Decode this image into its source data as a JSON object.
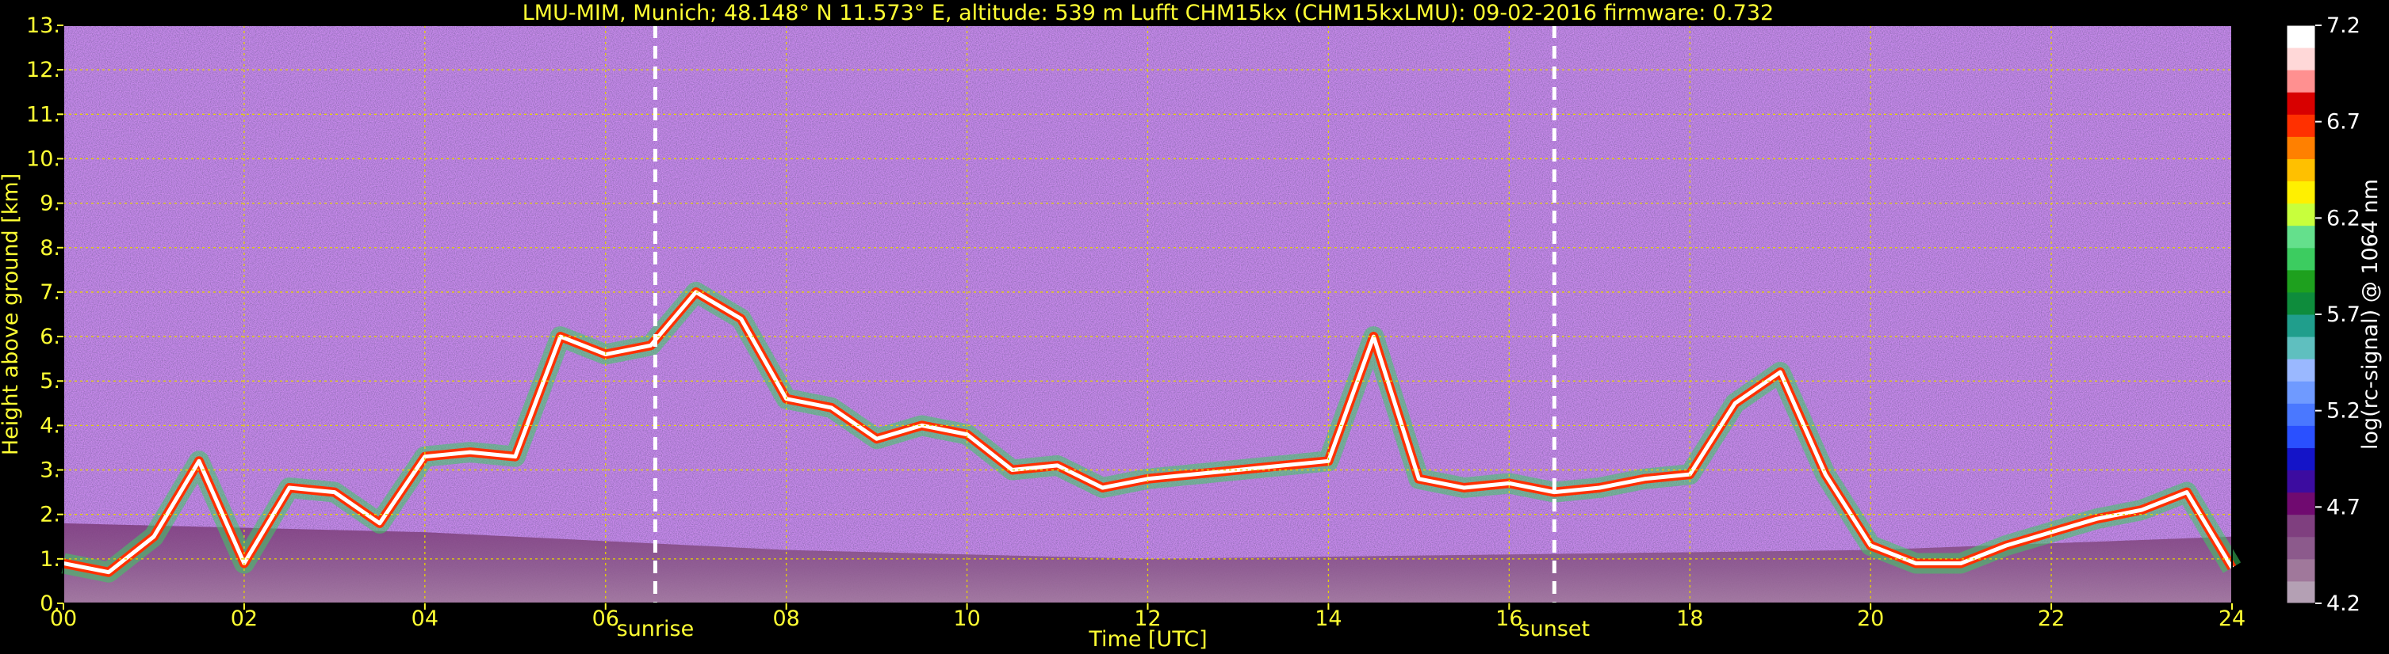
{
  "chart_data": {
    "type": "heatmap",
    "title": "LMU-MIM, Munich; 48.148° N 11.573° E, altitude: 539 m    Lufft CHM15kx (CHM15kxLMU): 09-02-2016    firmware: 0.732",
    "xlabel": "Time [UTC]",
    "ylabel": "Height above ground [km]",
    "xlim": [
      0,
      24
    ],
    "ylim": [
      0,
      13
    ],
    "x_ticks": [
      "00",
      "02",
      "04",
      "06",
      "08",
      "10",
      "12",
      "14",
      "16",
      "18",
      "20",
      "22",
      "24"
    ],
    "y_ticks": [
      "0.",
      "1.",
      "2.",
      "3.",
      "4.",
      "5.",
      "6.",
      "7.",
      "8.",
      "9.",
      "10.",
      "11.",
      "12.",
      "13."
    ],
    "grid": true,
    "markers": [
      {
        "label": "sunrise",
        "x": 6.55
      },
      {
        "label": "sunset",
        "x": 16.5
      }
    ],
    "colorbar": {
      "label": "log(rc-signal) @ 1064 nm",
      "range": [
        4.2,
        7.2
      ],
      "ticks": [
        "7.2",
        "6.7",
        "6.2",
        "5.7",
        "5.2",
        "4.7",
        "4.2"
      ],
      "colors": [
        "#b4a0b4",
        "#a0789b",
        "#8c5a8c",
        "#7f3f7f",
        "#700a70",
        "#3c0ca0",
        "#1414c8",
        "#2a50ff",
        "#4a78ff",
        "#6f9aff",
        "#9ab8ff",
        "#5fbfbf",
        "#209e8c",
        "#0e8c3c",
        "#1ea01e",
        "#3ccc60",
        "#64e08c",
        "#c8ff3c",
        "#fff000",
        "#ffc000",
        "#ff8000",
        "#ff3000",
        "#d80000",
        "#ff9090",
        "#ffd8d8",
        "#ffffff"
      ]
    },
    "layers": [
      {
        "name": "cloud_layer",
        "x": [
          0.0,
          0.5,
          1.0,
          1.5,
          2.0,
          2.5,
          3.0,
          3.5,
          4.0,
          4.5,
          5.0,
          5.5,
          6.0,
          6.5,
          7.0,
          7.5,
          8.0,
          8.5,
          9.0,
          9.5,
          10.0,
          10.5,
          11.0,
          11.5,
          12.0,
          12.5,
          13.0,
          13.5,
          14.0,
          14.5,
          15.0,
          15.5,
          16.0,
          16.5,
          17.0,
          17.5,
          18.0,
          18.5,
          19.0,
          19.5,
          20.0,
          20.5,
          21.0,
          21.5,
          22.0,
          22.5,
          23.0,
          23.5,
          24.0
        ],
        "y": [
          0.9,
          0.7,
          1.5,
          3.2,
          0.9,
          2.6,
          2.5,
          1.8,
          3.3,
          3.4,
          3.3,
          6.0,
          5.6,
          5.8,
          7.0,
          6.4,
          4.6,
          4.4,
          3.7,
          4.0,
          3.8,
          3.0,
          3.1,
          2.6,
          2.8,
          2.9,
          3.0,
          3.1,
          3.2,
          6.0,
          2.8,
          2.6,
          2.7,
          2.5,
          2.6,
          2.8,
          2.9,
          4.5,
          5.2,
          2.9,
          1.3,
          0.9,
          0.9,
          1.3,
          1.6,
          1.9,
          2.1,
          2.5,
          0.8
        ]
      }
    ],
    "boundary_layer": {
      "name": "aerosol_layer",
      "x": [
        0,
        4,
        8,
        12,
        16,
        20,
        24
      ],
      "y": [
        1.8,
        1.6,
        1.2,
        1.0,
        1.1,
        1.2,
        1.5
      ]
    }
  }
}
